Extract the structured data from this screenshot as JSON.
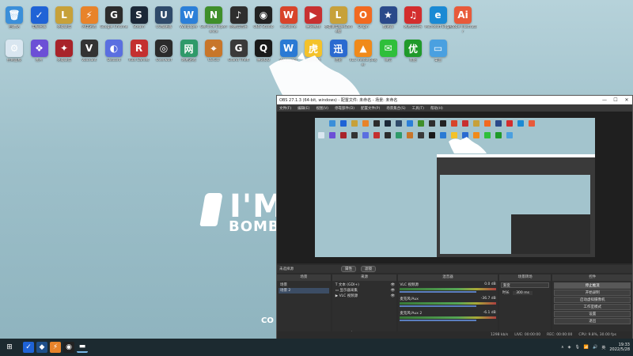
{
  "desktop": {
    "row1": [
      {
        "label": "回收站",
        "color": "#3b8fd9",
        "glyph": "🗑",
        "icon": "recycle-bin-icon"
      },
      {
        "label": "电脑管家",
        "color": "#1f63d6",
        "glyph": "✓",
        "icon": "pc-manager-icon"
      },
      {
        "label": "英雄联盟",
        "color": "#c7a13a",
        "glyph": "L",
        "icon": "lol-icon"
      },
      {
        "label": "闪电游戏",
        "color": "#e8832a",
        "glyph": "⚡",
        "icon": "game-icon"
      },
      {
        "label": "Google Chrome",
        "color": "#2c2c2c",
        "glyph": "G",
        "icon": "chrome-icon"
      },
      {
        "label": "Steam",
        "color": "#1b2838",
        "glyph": "S",
        "icon": "steam-icon"
      },
      {
        "label": "UU加速器",
        "color": "#2f4a6a",
        "glyph": "U",
        "icon": "uu-icon"
      },
      {
        "label": "Wallpaper",
        "color": "#2b7fd8",
        "glyph": "W",
        "icon": "wallpaper-icon"
      },
      {
        "label": "GeForce Experience",
        "color": "#3f8f2a",
        "glyph": "N",
        "icon": "nvidia-icon"
      },
      {
        "label": "网易云音乐",
        "color": "#2e2e2e",
        "glyph": "♪",
        "icon": "music-icon"
      },
      {
        "label": "OBS Studio",
        "color": "#222",
        "glyph": "◉",
        "icon": "obs-icon"
      },
      {
        "label": "WeGame",
        "color": "#d8442a",
        "glyph": "W",
        "icon": "wegame-icon"
      },
      {
        "label": "腾讯视频",
        "color": "#c83030",
        "glyph": "▶",
        "icon": "video-icon"
      },
      {
        "label": "英雄联盟WeGame版",
        "color": "#c7a13a",
        "glyph": "L",
        "icon": "lol-wegame-icon"
      },
      {
        "label": "Origin",
        "color": "#f26a20",
        "glyph": "O",
        "icon": "origin-icon"
      },
      {
        "label": "加速器",
        "color": "#2a4a8a",
        "glyph": "★",
        "icon": "accelerator-icon"
      },
      {
        "label": "网易云音乐",
        "color": "#d32d2d",
        "glyph": "♫",
        "icon": "netease-icon"
      },
      {
        "label": "Microsoft Edge",
        "color": "#1a8ad4",
        "glyph": "e",
        "icon": "edge-icon"
      },
      {
        "label": "Adobe Illustrator",
        "color": "#e85a3a",
        "glyph": "Ai",
        "icon": "adobe-icon"
      }
    ],
    "row2": [
      {
        "label": "控制面板",
        "color": "#d9e6f0",
        "glyph": "⚙",
        "icon": "control-panel-icon"
      },
      {
        "label": "图片",
        "color": "#6c4fd6",
        "glyph": "❖",
        "icon": "photos-icon"
      },
      {
        "label": "英雄联盟",
        "color": "#a8232a",
        "glyph": "✦",
        "icon": "hero-icon"
      },
      {
        "label": "Valorant",
        "color": "#333",
        "glyph": "V",
        "icon": "valorant-icon"
      },
      {
        "label": "Discord",
        "color": "#5a6fe0",
        "glyph": "◐",
        "icon": "discord-icon"
      },
      {
        "label": "Riot Games",
        "color": "#c43030",
        "glyph": "R",
        "icon": "riot-icon"
      },
      {
        "label": "Overwolf",
        "color": "#2b2b2b",
        "glyph": "◎",
        "icon": "overwolf-icon"
      },
      {
        "label": "网易游戏",
        "color": "#2f9a6a",
        "glyph": "网",
        "icon": "netgame-icon"
      },
      {
        "label": "CS:GO",
        "color": "#c8762a",
        "glyph": "⌖",
        "icon": "csgo-icon"
      },
      {
        "label": "Grand Theft",
        "color": "#3a3a3a",
        "glyph": "G",
        "icon": "gta-icon"
      },
      {
        "label": "腾讯QQ",
        "color": "#1a1a1a",
        "glyph": "Q",
        "icon": "qq-icon"
      },
      {
        "label": "Wallpaper",
        "color": "#2a7ad4",
        "glyph": "W",
        "icon": "wallpaper2-icon"
      },
      {
        "label": "虎牙直播",
        "color": "#f4c22a",
        "glyph": "虎",
        "icon": "huya-icon"
      },
      {
        "label": "迅雷",
        "color": "#2a6ad0",
        "glyph": "迅",
        "icon": "thunder-icon"
      },
      {
        "label": "VLC media player",
        "color": "#f08a1a",
        "glyph": "▲",
        "icon": "vlc-icon"
      },
      {
        "label": "微信",
        "color": "#2fbf3a",
        "glyph": "✉",
        "icon": "wechat-icon"
      },
      {
        "label": "优酷",
        "color": "#1f9a2a",
        "glyph": "优",
        "icon": "youku-icon"
      },
      {
        "label": "桌面",
        "color": "#4aa0e0",
        "glyph": "▭",
        "icon": "desktop-icon"
      }
    ],
    "logo_im": "I'M",
    "logo_bombs": "BOMBS",
    "co_text": "CO"
  },
  "obs": {
    "title": "OBS 27.1.3 (64-bit, windows) - 配置文件: 未命名 - 场景: 未命名",
    "menu": [
      "文件(F)",
      "编辑(E)",
      "视图(V)",
      "停靠部件(D)",
      "配置文件(P)",
      "场景集合(S)",
      "工具(T)",
      "帮助(H)"
    ],
    "scene_bar": {
      "label": "未选择源",
      "properties": "属性",
      "filters": "滤镜"
    },
    "docks": {
      "scenes": {
        "title": "场景",
        "items": [
          "场景",
          "场景 2"
        ],
        "selected": 1
      },
      "sources": {
        "title": "来源",
        "items": [
          "文本 (GDI+)",
          "显示器采集",
          "VLC 视频源"
        ]
      },
      "mixer": {
        "title": "混音器",
        "channels": [
          {
            "name": "VLC 视频源",
            "db": "0.0 dB"
          },
          {
            "name": "麦克风/Aux",
            "db": "-36.7 dB"
          },
          {
            "name": "麦克风/Aux 2",
            "db": "-6.1 dB"
          }
        ]
      },
      "transitions": {
        "title": "场景转场",
        "type": "渐变",
        "duration_label": "时长",
        "duration": "300 ms"
      },
      "controls": {
        "title": "控件",
        "buttons": [
          "停止推流",
          "开始录制",
          "启动虚拟摄像机",
          "工作室模式",
          "设置",
          "退出"
        ]
      }
    },
    "status": {
      "live": "LIVE: 00:00:00",
      "rec": "REC: 00:00:00",
      "cpu": "CPU: 9.8%, 30.00 fps",
      "kbps": "1298 kb/s"
    }
  },
  "taskbar": {
    "time": "19:33",
    "date": "2022/5/28"
  }
}
